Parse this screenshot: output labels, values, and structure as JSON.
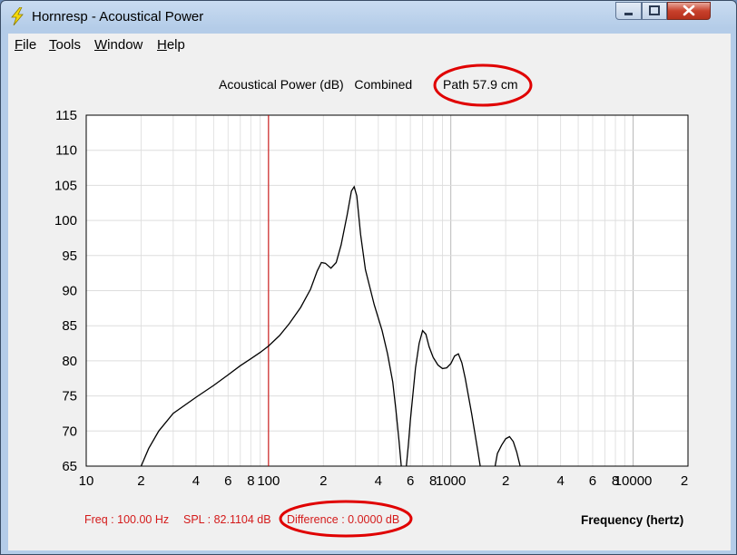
{
  "window": {
    "title": "Hornresp - Acoustical Power",
    "min_label": "–",
    "max_label": "□",
    "close_label": "✕"
  },
  "menu": [
    {
      "label": "File",
      "key": "F",
      "rest": "ile"
    },
    {
      "label": "Tools",
      "key": "T",
      "rest": "ools"
    },
    {
      "label": "Window",
      "key": "W",
      "rest": "indow"
    },
    {
      "label": "Help",
      "key": "H",
      "rest": "elp"
    }
  ],
  "plot": {
    "title_left": "Acoustical Power (dB)   Combined",
    "title_path": "Path 57.9 cm"
  },
  "status": {
    "freq": "Freq : 100.00 Hz",
    "spl": "SPL : 82.1104 dB",
    "difference": "Difference : 0.0000 dB"
  },
  "icons": {
    "app": "lightning-bolt-icon",
    "close": "close-icon",
    "minimize": "minimize-icon",
    "maximize": "maximize-icon"
  },
  "colors": {
    "curve": "#000000",
    "cursor": "#cc0000",
    "highlight_ellipse": "#e00000",
    "status_text": "#d41a1a"
  },
  "chart_data": {
    "type": "line",
    "title": "Acoustical Power (dB)   Combined   Path 57.9 cm",
    "xlabel": "Frequency (hertz)",
    "ylabel": "",
    "x_scale": "log",
    "xlim": [
      10,
      20000
    ],
    "ylim": [
      65,
      115
    ],
    "yticks": [
      "65",
      "70",
      "75",
      "80",
      "85",
      "90",
      "95",
      "100",
      "105",
      "110",
      "115"
    ],
    "xticks": [
      {
        "value": 10,
        "label": "10"
      },
      {
        "value": 20,
        "label": "2"
      },
      {
        "value": 40,
        "label": "4"
      },
      {
        "value": 60,
        "label": "6"
      },
      {
        "value": 80,
        "label": "8"
      },
      {
        "value": 100,
        "label": "100"
      },
      {
        "value": 200,
        "label": "2"
      },
      {
        "value": 400,
        "label": "4"
      },
      {
        "value": 600,
        "label": "6"
      },
      {
        "value": 800,
        "label": "8"
      },
      {
        "value": 1000,
        "label": "1000"
      },
      {
        "value": 2000,
        "label": "2"
      },
      {
        "value": 4000,
        "label": "4"
      },
      {
        "value": 6000,
        "label": "6"
      },
      {
        "value": 8000,
        "label": "8"
      },
      {
        "value": 10000,
        "label": "10000"
      },
      {
        "value": 20000,
        "label": "2"
      }
    ],
    "cursor_x": 100,
    "grid": true,
    "series": [
      {
        "segments": [
          [
            [
              20,
              65
            ],
            [
              22,
              67.5
            ],
            [
              25,
              70
            ],
            [
              30,
              72.5
            ],
            [
              40,
              74.8
            ],
            [
              50,
              76.5
            ],
            [
              60,
              78
            ],
            [
              70,
              79.3
            ],
            [
              80,
              80.3
            ],
            [
              90,
              81.2
            ],
            [
              100,
              82.1
            ],
            [
              115,
              83.6
            ],
            [
              130,
              85.3
            ],
            [
              150,
              87.6
            ],
            [
              170,
              90.2
            ],
            [
              185,
              92.8
            ],
            [
              195,
              94
            ],
            [
              205,
              93.9
            ],
            [
              220,
              93.2
            ],
            [
              235,
              94
            ],
            [
              250,
              96.5
            ],
            [
              270,
              100.8
            ],
            [
              285,
              104.2
            ],
            [
              295,
              104.8
            ],
            [
              305,
              103.5
            ],
            [
              320,
              98
            ],
            [
              340,
              93
            ],
            [
              380,
              88
            ],
            [
              420,
              84.3
            ],
            [
              450,
              81
            ],
            [
              480,
              77
            ],
            [
              500,
              73
            ],
            [
              520,
              68.5
            ],
            [
              535,
              65
            ]
          ],
          [
            [
              570,
              65
            ],
            [
              585,
              68
            ],
            [
              600,
              71.5
            ],
            [
              640,
              79
            ],
            [
              670,
              82.5
            ],
            [
              700,
              84.3
            ],
            [
              730,
              83.8
            ],
            [
              760,
              82
            ],
            [
              800,
              80.5
            ],
            [
              850,
              79.4
            ],
            [
              900,
              78.9
            ],
            [
              950,
              79
            ],
            [
              1000,
              79.6
            ],
            [
              1050,
              80.7
            ],
            [
              1100,
              81
            ],
            [
              1150,
              79.7
            ],
            [
              1200,
              77.5
            ],
            [
              1300,
              72.5
            ],
            [
              1400,
              67.5
            ],
            [
              1450,
              65
            ]
          ],
          [
            [
              1750,
              65
            ],
            [
              1800,
              66.8
            ],
            [
              1900,
              68
            ],
            [
              2000,
              68.9
            ],
            [
              2100,
              69.2
            ],
            [
              2200,
              68.5
            ],
            [
              2300,
              67
            ],
            [
              2400,
              65
            ]
          ]
        ]
      }
    ],
    "highlights": [
      "Path 57.9 cm",
      "Difference : 0.0000 dB"
    ]
  }
}
